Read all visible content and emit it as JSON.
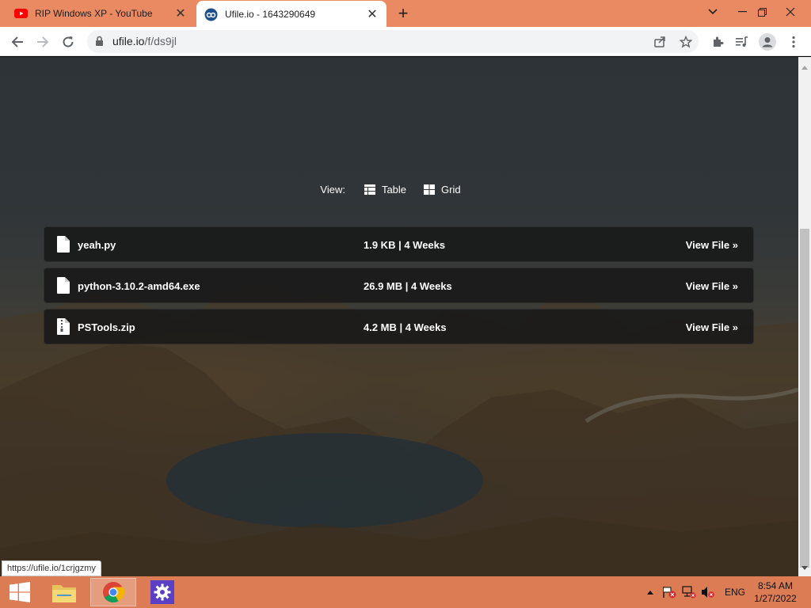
{
  "browser": {
    "tabs": [
      {
        "title": "RIP Windows XP - YouTube",
        "icon": "youtube-icon",
        "active": false
      },
      {
        "title": "Ufile.io - 1643290649",
        "icon": "ufile-icon",
        "active": true
      }
    ],
    "url_host": "ufile.io",
    "url_path": "/f/ds9jl"
  },
  "page": {
    "view_label": "View:",
    "view_options": [
      {
        "label": "Table",
        "icon": "table-icon"
      },
      {
        "label": "Grid",
        "icon": "grid-icon"
      }
    ],
    "files": [
      {
        "name": "yeah.py",
        "meta": "1.9 KB | 4 Weeks",
        "action": "View File »",
        "icon": "file-icon"
      },
      {
        "name": "python-3.10.2-amd64.exe",
        "meta": "26.9 MB | 4 Weeks",
        "action": "View File »",
        "icon": "file-icon"
      },
      {
        "name": "PSTools.zip",
        "meta": "4.2 MB | 4 Weeks",
        "action": "View File »",
        "icon": "zip-file-icon"
      }
    ]
  },
  "status_bar": {
    "link_preview": "https://ufile.io/1crjgzmy"
  },
  "taskbar": {
    "language": "ENG",
    "time": "8:54 AM",
    "date": "1/27/2022"
  },
  "colors": {
    "tabstrip": "#e98a62",
    "taskbar": "#dc7c55",
    "row_bg": "#161616"
  }
}
